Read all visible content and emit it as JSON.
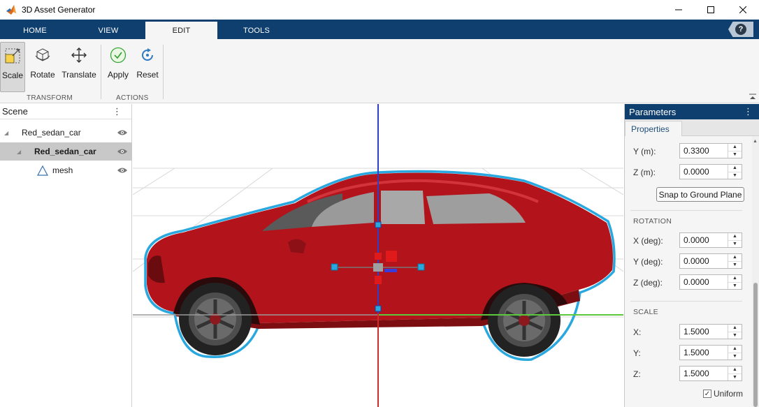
{
  "window": {
    "title": "3D Asset Generator",
    "icons": [
      "matlab-logo-icon",
      "minimize-icon",
      "maximize-icon",
      "close-icon"
    ]
  },
  "tabs": [
    {
      "label": "HOME",
      "active": false
    },
    {
      "label": "VIEW",
      "active": false
    },
    {
      "label": "EDIT",
      "active": true
    },
    {
      "label": "TOOLS",
      "active": false
    }
  ],
  "help_label": "?",
  "toolstrip": {
    "tools": [
      {
        "label": "Scale",
        "icon": "scale-icon",
        "selected": true
      },
      {
        "label": "Rotate",
        "icon": "rotate-icon",
        "selected": false
      },
      {
        "label": "Translate",
        "icon": "translate-icon",
        "selected": false
      },
      {
        "label": "Apply",
        "icon": "apply-check-icon",
        "selected": false
      },
      {
        "label": "Reset",
        "icon": "reset-icon",
        "selected": false
      }
    ],
    "sections": [
      "TRANSFORM",
      "ACTIONS"
    ]
  },
  "scene": {
    "title": "Scene",
    "menu_icon": "⋮",
    "items": [
      {
        "label": "Red_sedan_car",
        "level": 0,
        "selected": false
      },
      {
        "label": "Red_sedan_car",
        "level": 1,
        "selected": true
      },
      {
        "label": "mesh",
        "level": 2,
        "selected": false
      }
    ]
  },
  "parameters": {
    "title": "Parameters",
    "menu_icon": "⋮",
    "tab": "Properties",
    "position": [
      {
        "label": "Y (m):",
        "value": "0.3300"
      },
      {
        "label": "Z (m):",
        "value": "0.0000"
      }
    ],
    "snap_label": "Snap to Ground Plane",
    "rotation_title": "ROTATION",
    "rotation": [
      {
        "label": "X (deg):",
        "value": "0.0000"
      },
      {
        "label": "Y (deg):",
        "value": "0.0000"
      },
      {
        "label": "Z (deg):",
        "value": "0.0000"
      }
    ],
    "scale_title": "SCALE",
    "scale": [
      {
        "label": "X:",
        "value": "1.5000"
      },
      {
        "label": "Y:",
        "value": "1.5000"
      },
      {
        "label": "Z:",
        "value": "1.5000"
      }
    ],
    "uniform_label": "Uniform",
    "uniform_checked": true
  },
  "colors": {
    "accent": "#0f3f6e",
    "car_body": "#b3141c",
    "selection_outline": "#29a8df",
    "axis_x": "#5cc83c",
    "axis_y": "#2d3fc4",
    "axis_z": "#d02a2a"
  }
}
